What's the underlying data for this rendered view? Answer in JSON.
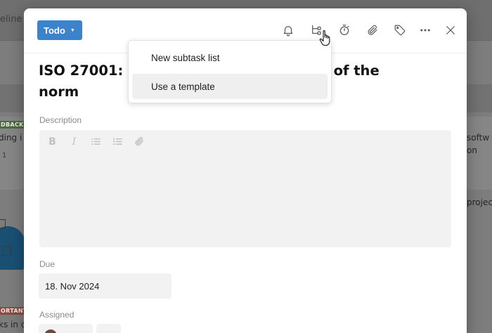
{
  "background": {
    "timeline_tab": "eline",
    "cards": {
      "feedback_badge": "DBACK",
      "card_left_text": "ding i",
      "card_left_meta": "1",
      "card_right_line1": "softw",
      "card_right_line2": "on",
      "card_right_2": "projec",
      "important_badge": "ORTANT",
      "card_bottom_text": "ks in c"
    }
  },
  "modal": {
    "status_label": "Todo",
    "header_icons": [
      "bell-icon",
      "subtask-icon",
      "timer-icon",
      "paperclip-icon",
      "tag-icon",
      "more-icon",
      "close-icon"
    ],
    "title": "ISO 27001: d",
    "title_end": "enefits of the",
    "title_line2": "norm",
    "description_label": "Description",
    "editor_tools": [
      "bold-icon",
      "italic-icon",
      "bullet-list-icon",
      "numbered-list-icon",
      "attach-icon"
    ],
    "due_label": "Due",
    "due_value": "18. Nov 2024",
    "assigned_label": "Assigned"
  },
  "subtask_menu": {
    "items": [
      {
        "label": "New subtask list",
        "active": false
      },
      {
        "label": "Use a template",
        "active": true
      }
    ]
  },
  "colors": {
    "status_button": "#3d83cc",
    "menu_hover": "#efefef",
    "editor_bg": "#f2f2f2"
  }
}
